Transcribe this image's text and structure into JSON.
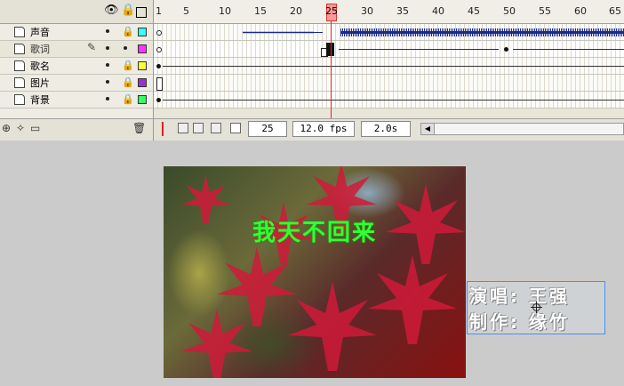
{
  "layers": [
    {
      "name": "声音",
      "color": "#33ffff"
    },
    {
      "name": "歌词",
      "color": "#ff33ff",
      "selected": true
    },
    {
      "name": "歌名",
      "color": "#ffff33"
    },
    {
      "name": "图片",
      "color": "#9933cc"
    },
    {
      "name": "背景",
      "color": "#33ff66"
    }
  ],
  "ruler": {
    "ticks": [
      "1",
      "5",
      "10",
      "15",
      "20",
      "25",
      "30",
      "35",
      "40",
      "45",
      "50",
      "55",
      "60",
      "65"
    ],
    "current_frame_marker": "25"
  },
  "controls": {
    "current_frame": "25",
    "frame_rate": "12.0 fps",
    "elapsed_time": "2.0s"
  },
  "stage": {
    "lyric": "我天不回来",
    "credits": [
      "演唱: 王强",
      "制作: 缘竹"
    ]
  }
}
